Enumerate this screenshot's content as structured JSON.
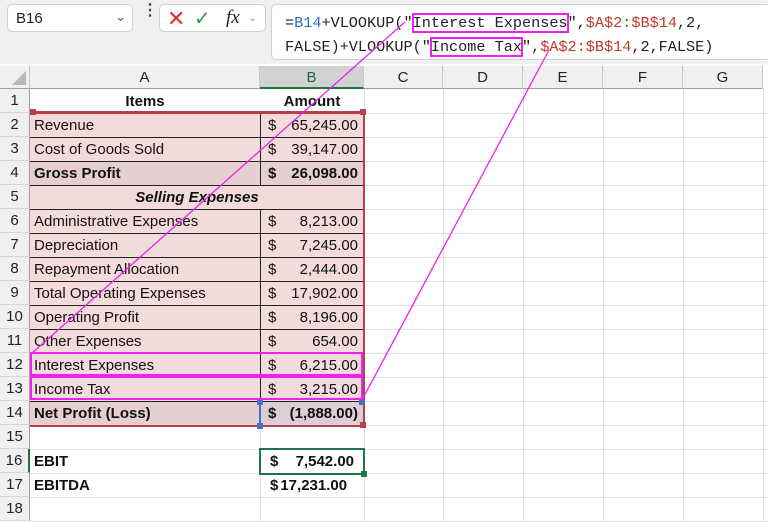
{
  "formula_bar": {
    "name_box": "B16",
    "cancel_icon": "✕",
    "enter_icon": "✓",
    "fx_label": "fx",
    "formula_parts": {
      "eq": "=",
      "ref1": "B14",
      "p1": "+VLOOKUP(\"",
      "lookup1": "Interest Expenses",
      "q1": "\",",
      "range1": "$A$2:$B$14",
      "tail1": ",2,",
      "line2a": "FALSE)+VLOOKUP(\"",
      "lookup2": "Income Tax",
      "q2": "\",",
      "range2": "$A$2:$B$14",
      "tail2": ",2,FALSE)"
    },
    "full_formula": "=B14+VLOOKUP(\"Interest Expenses\",$A$2:$B$14,2,FALSE)+VLOOKUP(\"Income Tax\",$A$2:$B$14,2,FALSE)"
  },
  "columns": [
    "A",
    "B",
    "C",
    "D",
    "E",
    "F",
    "G"
  ],
  "selected_column": "B",
  "row_numbers": [
    "1",
    "2",
    "3",
    "4",
    "5",
    "6",
    "7",
    "8",
    "9",
    "10",
    "11",
    "12",
    "13",
    "14",
    "15",
    "16",
    "17",
    "18"
  ],
  "selected_row": "16",
  "table": {
    "header": {
      "items": "Items",
      "amount": "Amount"
    },
    "rows": [
      {
        "row": "2",
        "item": "Revenue",
        "cur": "$",
        "amount": "65,245.00",
        "style": "normal"
      },
      {
        "row": "3",
        "item": "Cost of Goods Sold",
        "cur": "$",
        "amount": "39,147.00",
        "style": "normal"
      },
      {
        "row": "4",
        "item": "Gross Profit",
        "cur": "$",
        "amount": "26,098.00",
        "style": "bold"
      },
      {
        "row": "5",
        "item": "Selling Expenses",
        "cur": "",
        "amount": "",
        "style": "section"
      },
      {
        "row": "6",
        "item": "Administrative Expenses",
        "cur": "$",
        "amount": "8,213.00",
        "style": "normal"
      },
      {
        "row": "7",
        "item": "Depreciation",
        "cur": "$",
        "amount": "7,245.00",
        "style": "normal"
      },
      {
        "row": "8",
        "item": "Repayment Allocation",
        "cur": "$",
        "amount": "2,444.00",
        "style": "normal"
      },
      {
        "row": "9",
        "item": "Total Operating Expenses",
        "cur": "$",
        "amount": "17,902.00",
        "style": "normal"
      },
      {
        "row": "10",
        "item": "Operating Profit",
        "cur": "$",
        "amount": "8,196.00",
        "style": "normal"
      },
      {
        "row": "11",
        "item": "Other Expenses",
        "cur": "$",
        "amount": "654.00",
        "style": "normal"
      },
      {
        "row": "12",
        "item": "Interest Expenses",
        "cur": "$",
        "amount": "6,215.00",
        "style": "normal"
      },
      {
        "row": "13",
        "item": "Income Tax",
        "cur": "$",
        "amount": "3,215.00",
        "style": "normal"
      },
      {
        "row": "14",
        "item": "Net Profit (Loss)",
        "cur": "$",
        "amount": "(1,888.00)",
        "style": "bold"
      }
    ]
  },
  "summary": [
    {
      "row": "16",
      "label": "EBIT",
      "cur": "$",
      "amount": "7,542.00"
    },
    {
      "row": "17",
      "label": "EBITDA",
      "cur": "$",
      "amount": "17,231.00"
    }
  ],
  "colors": {
    "table_fill": "#f2dcdb",
    "table_border": "#b8404a",
    "highlight": "#ee22ee",
    "active_cell": "#217346",
    "ref_blue": "#4a6fc2"
  }
}
